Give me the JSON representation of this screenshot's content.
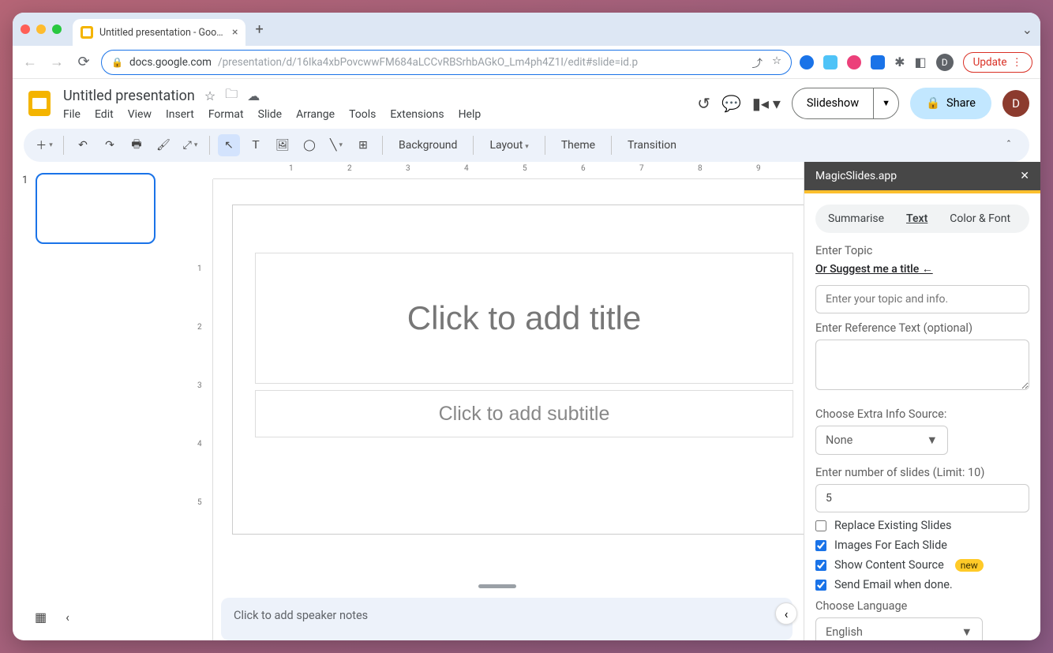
{
  "browser": {
    "tab_title": "Untitled presentation - Google",
    "url_host": "docs.google.com",
    "url_path": "/presentation/d/16Ika4xbPovcwwFM684aLCCvRBSrhbAGkO_Lm4ph4Z1I/edit#slide=id.p",
    "update_label": "Update",
    "avatar_letter": "D"
  },
  "header": {
    "doc_title": "Untitled presentation",
    "menus": [
      "File",
      "Edit",
      "View",
      "Insert",
      "Format",
      "Slide",
      "Arrange",
      "Tools",
      "Extensions",
      "Help"
    ],
    "slideshow_label": "Slideshow",
    "share_label": "Share",
    "avatar_letter": "D"
  },
  "toolbar": {
    "background": "Background",
    "layout": "Layout",
    "theme": "Theme",
    "transition": "Transition"
  },
  "filmstrip": {
    "slide_number": "1"
  },
  "slide": {
    "title_placeholder": "Click to add title",
    "subtitle_placeholder": "Click to add subtitle"
  },
  "notes": {
    "placeholder": "Click to add speaker notes"
  },
  "ruler": {
    "h": [
      "1",
      "2",
      "3",
      "4",
      "5",
      "6",
      "7",
      "8",
      "9"
    ],
    "v": [
      "1",
      "2",
      "3",
      "4",
      "5"
    ]
  },
  "sidepanel": {
    "title": "MagicSlides.app",
    "tabs": [
      "Summarise",
      "Text",
      "Color & Font"
    ],
    "active_tab": "Text",
    "enter_topic_label": "Enter Topic",
    "suggest_link": "Or Suggest me a title ←",
    "topic_placeholder": "Enter your topic and info.",
    "reference_label": "Enter Reference Text (optional)",
    "extra_info_label": "Choose Extra Info Source:",
    "extra_info_value": "None",
    "num_slides_label": "Enter number of slides (Limit: 10)",
    "num_slides_value": "5",
    "opt_replace": "Replace Existing Slides",
    "opt_images": "Images For Each Slide",
    "opt_source": "Show Content Source",
    "badge_new": "new",
    "opt_email": "Send Email when done.",
    "language_label": "Choose Language",
    "language_value": "English"
  }
}
